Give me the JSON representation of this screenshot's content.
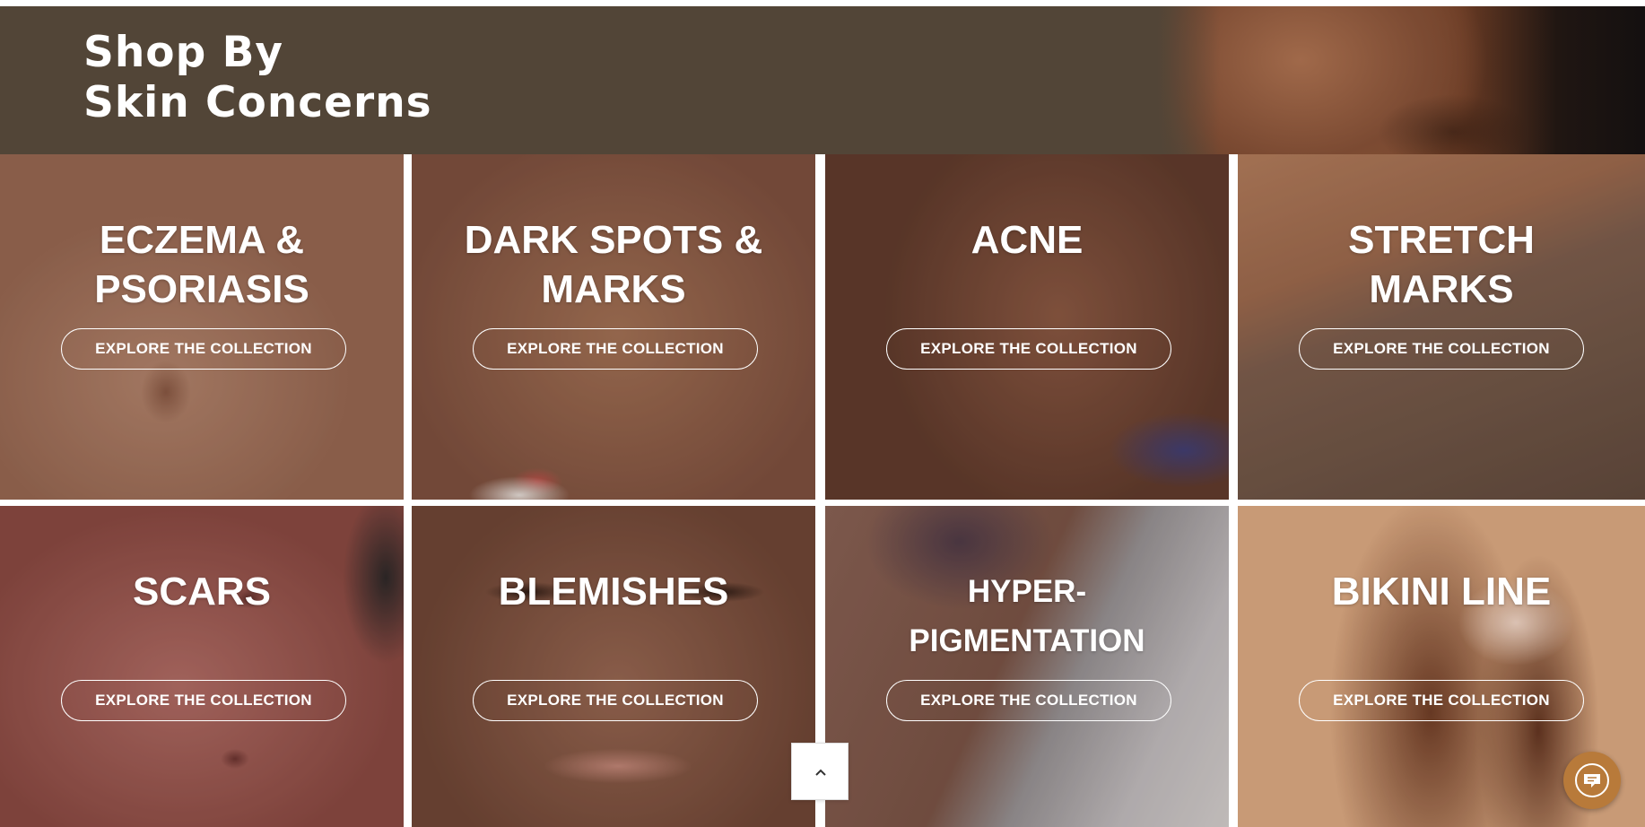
{
  "banner": {
    "title_line1": "Shop By",
    "title_line2": "Skin Concerns",
    "background_color": "#524537"
  },
  "tiles": [
    {
      "heading_line1": "ECZEMA &",
      "heading_line2": "PSORIASIS",
      "cta_label": "EXPLORE THE COLLECTION"
    },
    {
      "heading_line1": "DARK SPOTS &",
      "heading_line2": "MARKS",
      "cta_label": "EXPLORE THE COLLECTION"
    },
    {
      "heading_line1": "ACNE",
      "heading_line2": "",
      "cta_label": "EXPLORE THE COLLECTION"
    },
    {
      "heading_line1": "STRETCH",
      "heading_line2": "MARKS",
      "cta_label": "EXPLORE THE COLLECTION"
    },
    {
      "heading_line1": "SCARS",
      "heading_line2": "",
      "cta_label": "EXPLORE THE COLLECTION"
    },
    {
      "heading_line1": "BLEMISHES",
      "heading_line2": "",
      "cta_label": "EXPLORE THE COLLECTION"
    },
    {
      "heading_line1": "HYPER-",
      "heading_line2": "PIGMENTATION",
      "cta_label": "EXPLORE THE COLLECTION"
    },
    {
      "heading_line1": "BIKINI LINE",
      "heading_line2": "",
      "cta_label": "EXPLORE THE COLLECTION"
    }
  ],
  "widgets": {
    "back_to_top_icon": "chevron-up-icon",
    "chat_icon": "chat-bubble-icon",
    "chat_color": "#b87a3a"
  }
}
